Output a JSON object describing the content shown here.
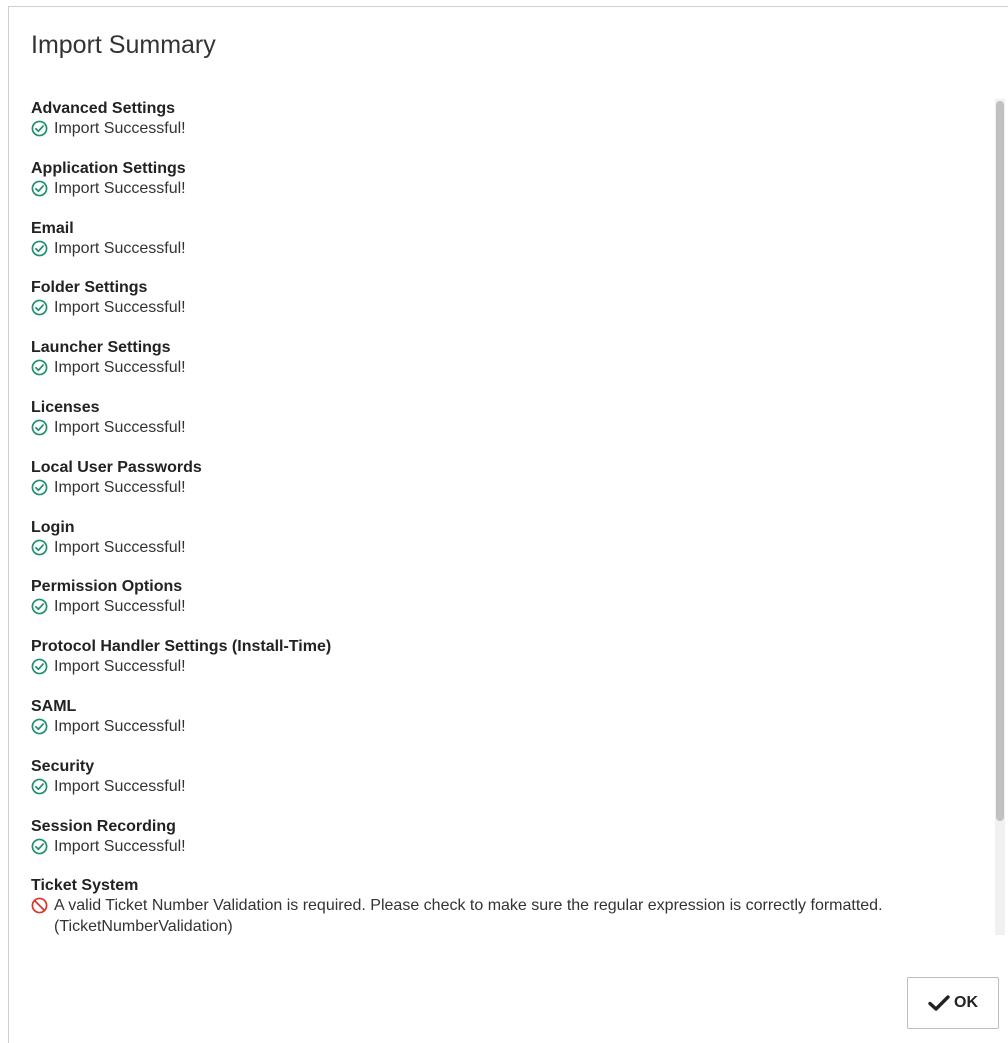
{
  "dialog": {
    "title": "Import Summary"
  },
  "items": [
    {
      "title": "Advanced Settings",
      "status": "success",
      "message": "Import Successful!"
    },
    {
      "title": "Application Settings",
      "status": "success",
      "message": "Import Successful!"
    },
    {
      "title": "Email",
      "status": "success",
      "message": "Import Successful!"
    },
    {
      "title": "Folder Settings",
      "status": "success",
      "message": "Import Successful!"
    },
    {
      "title": "Launcher Settings",
      "status": "success",
      "message": "Import Successful!"
    },
    {
      "title": "Licenses",
      "status": "success",
      "message": "Import Successful!"
    },
    {
      "title": "Local User Passwords",
      "status": "success",
      "message": "Import Successful!"
    },
    {
      "title": "Login",
      "status": "success",
      "message": "Import Successful!"
    },
    {
      "title": "Permission Options",
      "status": "success",
      "message": "Import Successful!"
    },
    {
      "title": "Protocol Handler Settings (Install-Time)",
      "status": "success",
      "message": "Import Successful!"
    },
    {
      "title": "SAML",
      "status": "success",
      "message": "Import Successful!"
    },
    {
      "title": "Security",
      "status": "success",
      "message": "Import Successful!"
    },
    {
      "title": "Session Recording",
      "status": "success",
      "message": "Import Successful!"
    },
    {
      "title": "Ticket System",
      "status": "error",
      "message": "A valid Ticket Number Validation is required. Please check to make sure the regular expression is correctly formatted. (TicketNumberValidation)"
    }
  ],
  "icons": {
    "success": "check-circle-icon",
    "error": "prohibited-icon",
    "ok": "check-icon"
  },
  "colors": {
    "success": "#1f8f6e",
    "error": "#d9362b"
  },
  "footer": {
    "ok_label": "OK"
  }
}
